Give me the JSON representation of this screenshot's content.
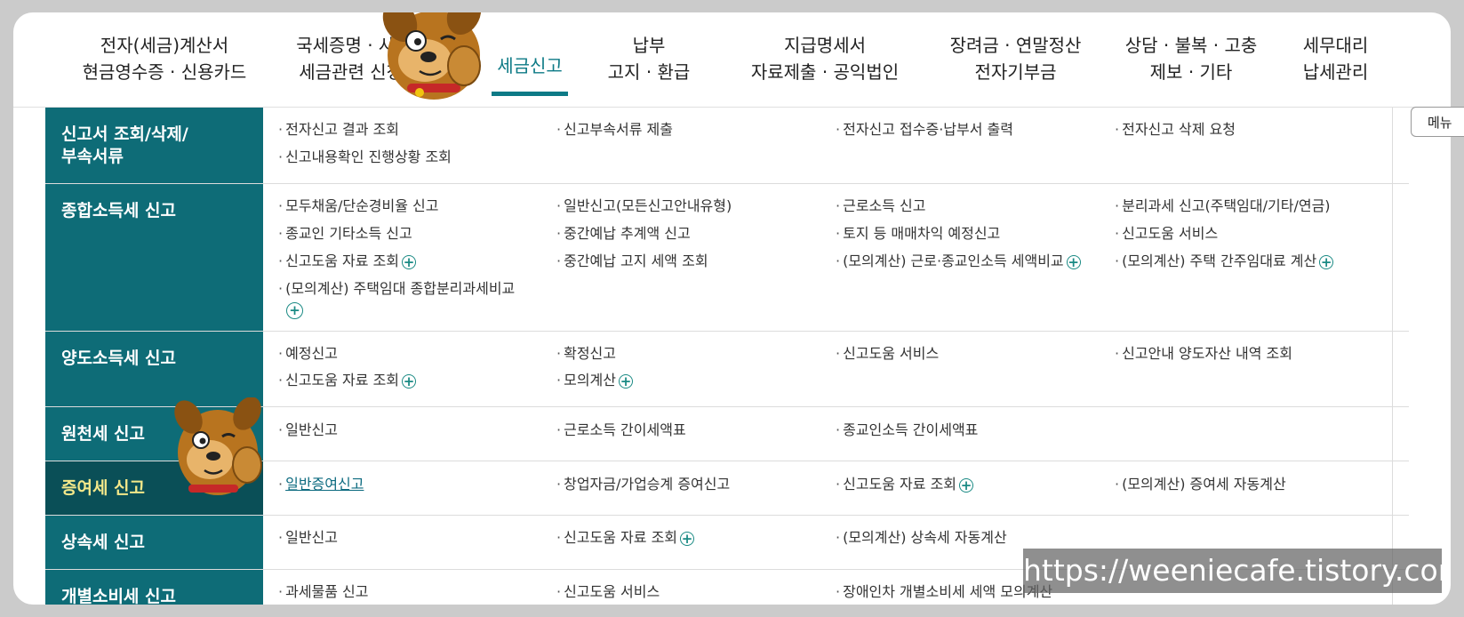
{
  "nav": {
    "tabs": [
      {
        "line1": "전자(세금)계산서",
        "line2": "현금영수증 · 신용카드"
      },
      {
        "line1": "국세증명 · 사업",
        "line2": "세금관련 신청/"
      },
      {
        "line1": "세금신고",
        "line2": ""
      },
      {
        "line1": "납부",
        "line2": "고지 · 환급"
      },
      {
        "line1": "지급명세서",
        "line2": "자료제출 · 공익법인"
      },
      {
        "line1": "장려금 · 연말정산",
        "line2": "전자기부금"
      },
      {
        "line1": "상담 · 불복 · 고충",
        "line2": "제보 · 기타"
      },
      {
        "line1": "세무대리",
        "line2": "납세관리"
      }
    ],
    "active_index": 2
  },
  "menu_button": "메뉴",
  "rows": [
    {
      "title_line1": "신고서 조회/삭제/",
      "title_line2": "부속서류",
      "items": [
        {
          "text": "전자신고 결과 조회"
        },
        {
          "text": "신고부속서류 제출"
        },
        {
          "text": "전자신고 접수증·납부서 출력"
        },
        {
          "text": "전자신고 삭제 요청"
        },
        {
          "text": "신고내용확인 진행상황 조회"
        }
      ]
    },
    {
      "title_line1": "종합소득세 신고",
      "items": [
        {
          "text": "모두채움/단순경비율 신고"
        },
        {
          "text": "일반신고(모든신고안내유형)"
        },
        {
          "text": "근로소득 신고"
        },
        {
          "text": "분리과세 신고(주택임대/기타/연금)"
        },
        {
          "text": "종교인 기타소득 신고"
        },
        {
          "text": "중간예납 추계액 신고"
        },
        {
          "text": "토지 등 매매차익 예정신고"
        },
        {
          "text": "신고도움 서비스"
        },
        {
          "text": "신고도움 자료 조회"
        },
        {
          "text": "중간예납 고지 세액 조회"
        },
        {
          "text": "(모의계산) 근로·종교인소득 세액비교"
        },
        {
          "text": "(모의계산) 주택 간주임대료 계산"
        },
        {
          "text": "(모의계산) 주택임대 종합분리과세비교"
        }
      ]
    },
    {
      "title_line1": "양도소득세 신고",
      "items": [
        {
          "text": "예정신고"
        },
        {
          "text": "확정신고"
        },
        {
          "text": "신고도움 서비스"
        },
        {
          "text": "신고안내 양도자산 내역 조회"
        },
        {
          "text": "신고도움 자료 조회"
        },
        {
          "text": "모의계산"
        }
      ]
    },
    {
      "title_line1": "원천세 신고",
      "items": [
        {
          "text": "일반신고"
        },
        {
          "text": "근로소득 간이세액표"
        },
        {
          "text": "종교인소득 간이세액표"
        }
      ]
    },
    {
      "title_line1": "증여세 신고",
      "items": [
        {
          "text": "일반증여신고"
        },
        {
          "text": "창업자금/가업승계 증여신고"
        },
        {
          "text": "신고도움 자료 조회"
        },
        {
          "text": "(모의계산) 증여세 자동계산"
        }
      ]
    },
    {
      "title_line1": "상속세 신고",
      "items": [
        {
          "text": "일반신고"
        },
        {
          "text": "신고도움 자료 조회"
        },
        {
          "text": "(모의계산) 상속세 자동계산"
        }
      ]
    },
    {
      "title_line1": "개별소비세 신고",
      "items": [
        {
          "text": "과세물품 신고"
        },
        {
          "text": "신고도움 서비스"
        },
        {
          "text": "장애인차 개별소비세 세액 모의계산"
        }
      ]
    }
  ],
  "watermark": "https://weeniecafe.tistory.com",
  "colors": {
    "header_teal": "#0e6c77",
    "active_row": "#0a4f57",
    "active_row_text": "#f3e88a",
    "accent": "#0d7a86"
  }
}
